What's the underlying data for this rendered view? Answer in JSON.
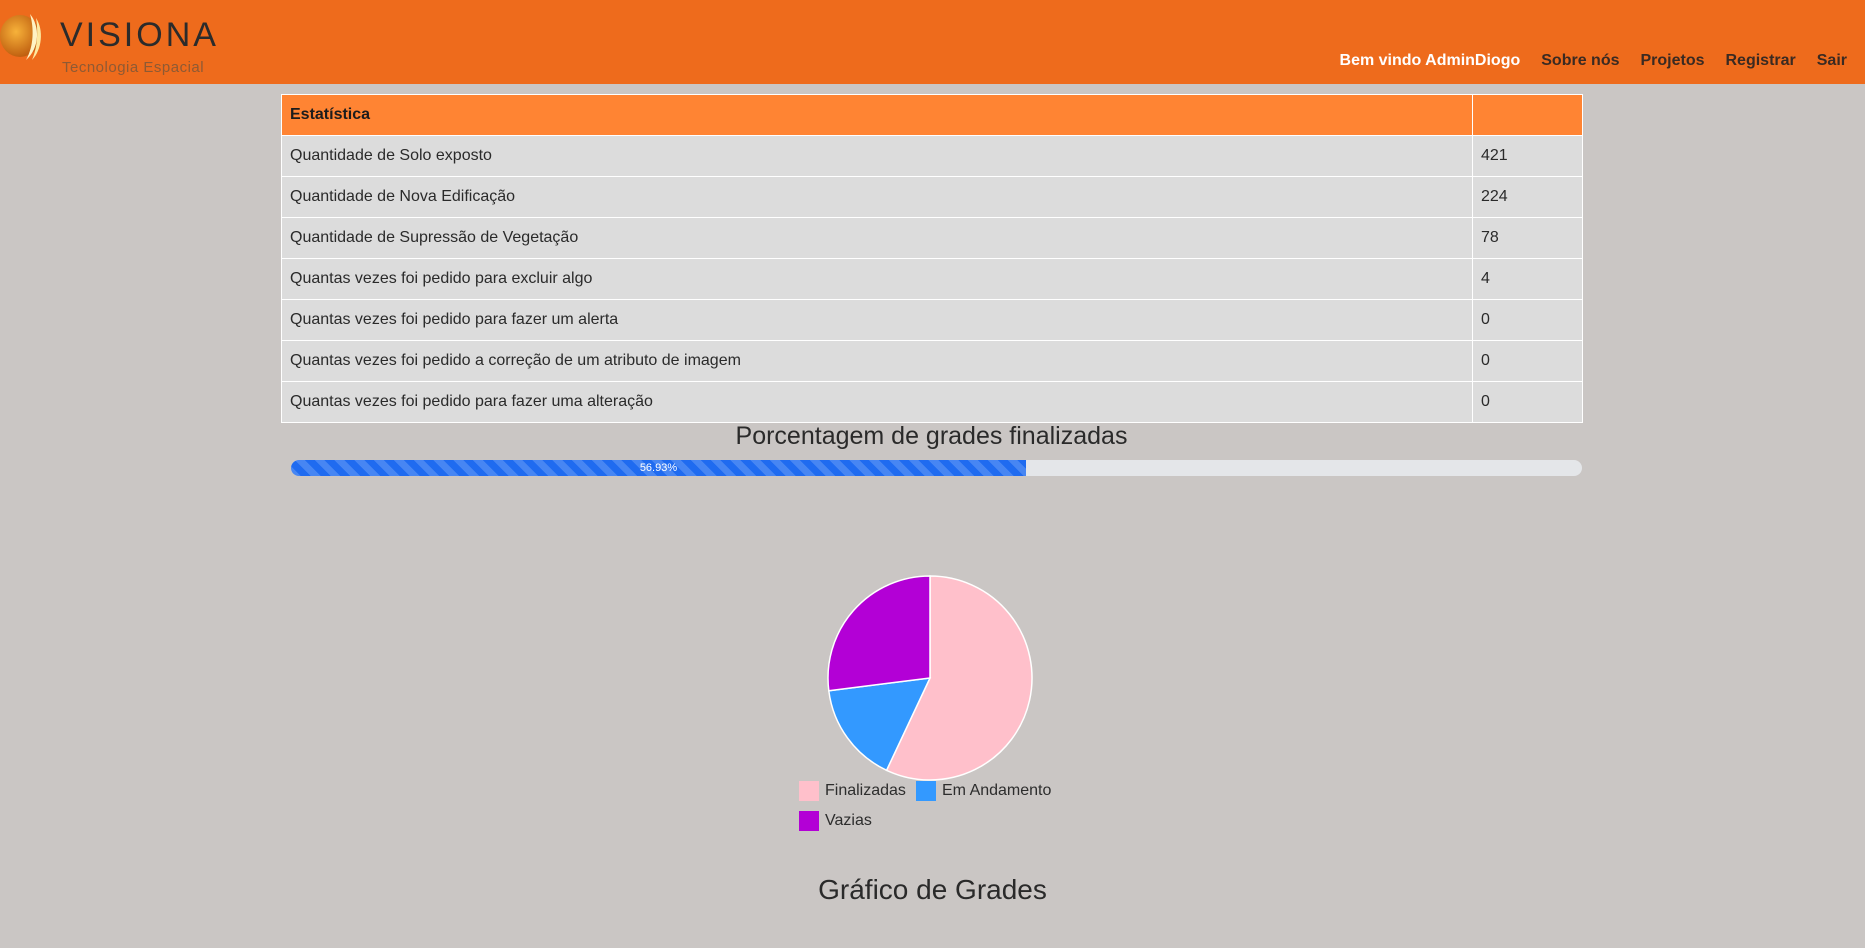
{
  "header": {
    "logo_text": "VISIONA",
    "logo_sub": "Tecnologia Espacial",
    "nav": [
      {
        "label": "Bem vindo AdminDiogo"
      },
      {
        "label": "Sobre nós"
      },
      {
        "label": "Projetos"
      },
      {
        "label": "Registrar"
      },
      {
        "label": "Sair"
      }
    ]
  },
  "stats": {
    "header": "Estatística",
    "rows": [
      {
        "label": "Quantidade de Solo exposto",
        "value": "421"
      },
      {
        "label": "Quantidade de Nova Edificação",
        "value": "224"
      },
      {
        "label": "Quantidade de Supressão de Vegetação",
        "value": "78"
      },
      {
        "label": "Quantas vezes foi pedido para excluir algo",
        "value": "4"
      },
      {
        "label": "Quantas vezes foi pedido para fazer um alerta",
        "value": "0"
      },
      {
        "label": "Quantas vezes foi pedido a correção de um atributo de imagem",
        "value": "0"
      },
      {
        "label": "Quantas vezes foi pedido para fazer uma alteração",
        "value": "0"
      }
    ]
  },
  "progress": {
    "title": "Porcentagem de grades finalizadas",
    "label": "56.93%",
    "percent": 56.93
  },
  "chart_data": {
    "type": "pie",
    "title": "Gráfico de Grades",
    "categories": [
      "Finalizadas",
      "Em Andamento",
      "Vazias"
    ],
    "values": [
      57,
      16,
      27
    ],
    "colors": [
      "#ffc0cb",
      "#3399ff",
      "#b300d6"
    ],
    "legend": "bottom"
  }
}
